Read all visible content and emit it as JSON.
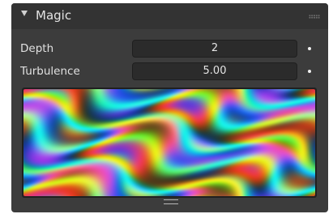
{
  "panel": {
    "title": "Magic",
    "collapse_icon": "triangle-down-icon",
    "drag_icon": "grip-dots-icon"
  },
  "fields": {
    "depth": {
      "label": "Depth",
      "value": "2"
    },
    "turbulence": {
      "label": "Turbulence",
      "value": "5.00"
    }
  },
  "preview": {
    "description_icon": "magic-texture-preview",
    "resize_icon": "resize-handle-icon"
  },
  "colors": {
    "panel_bg": "#3c3c3c",
    "header_bg": "#333333",
    "field_bg": "#2b2b2b",
    "text": "#e4e4e4"
  }
}
